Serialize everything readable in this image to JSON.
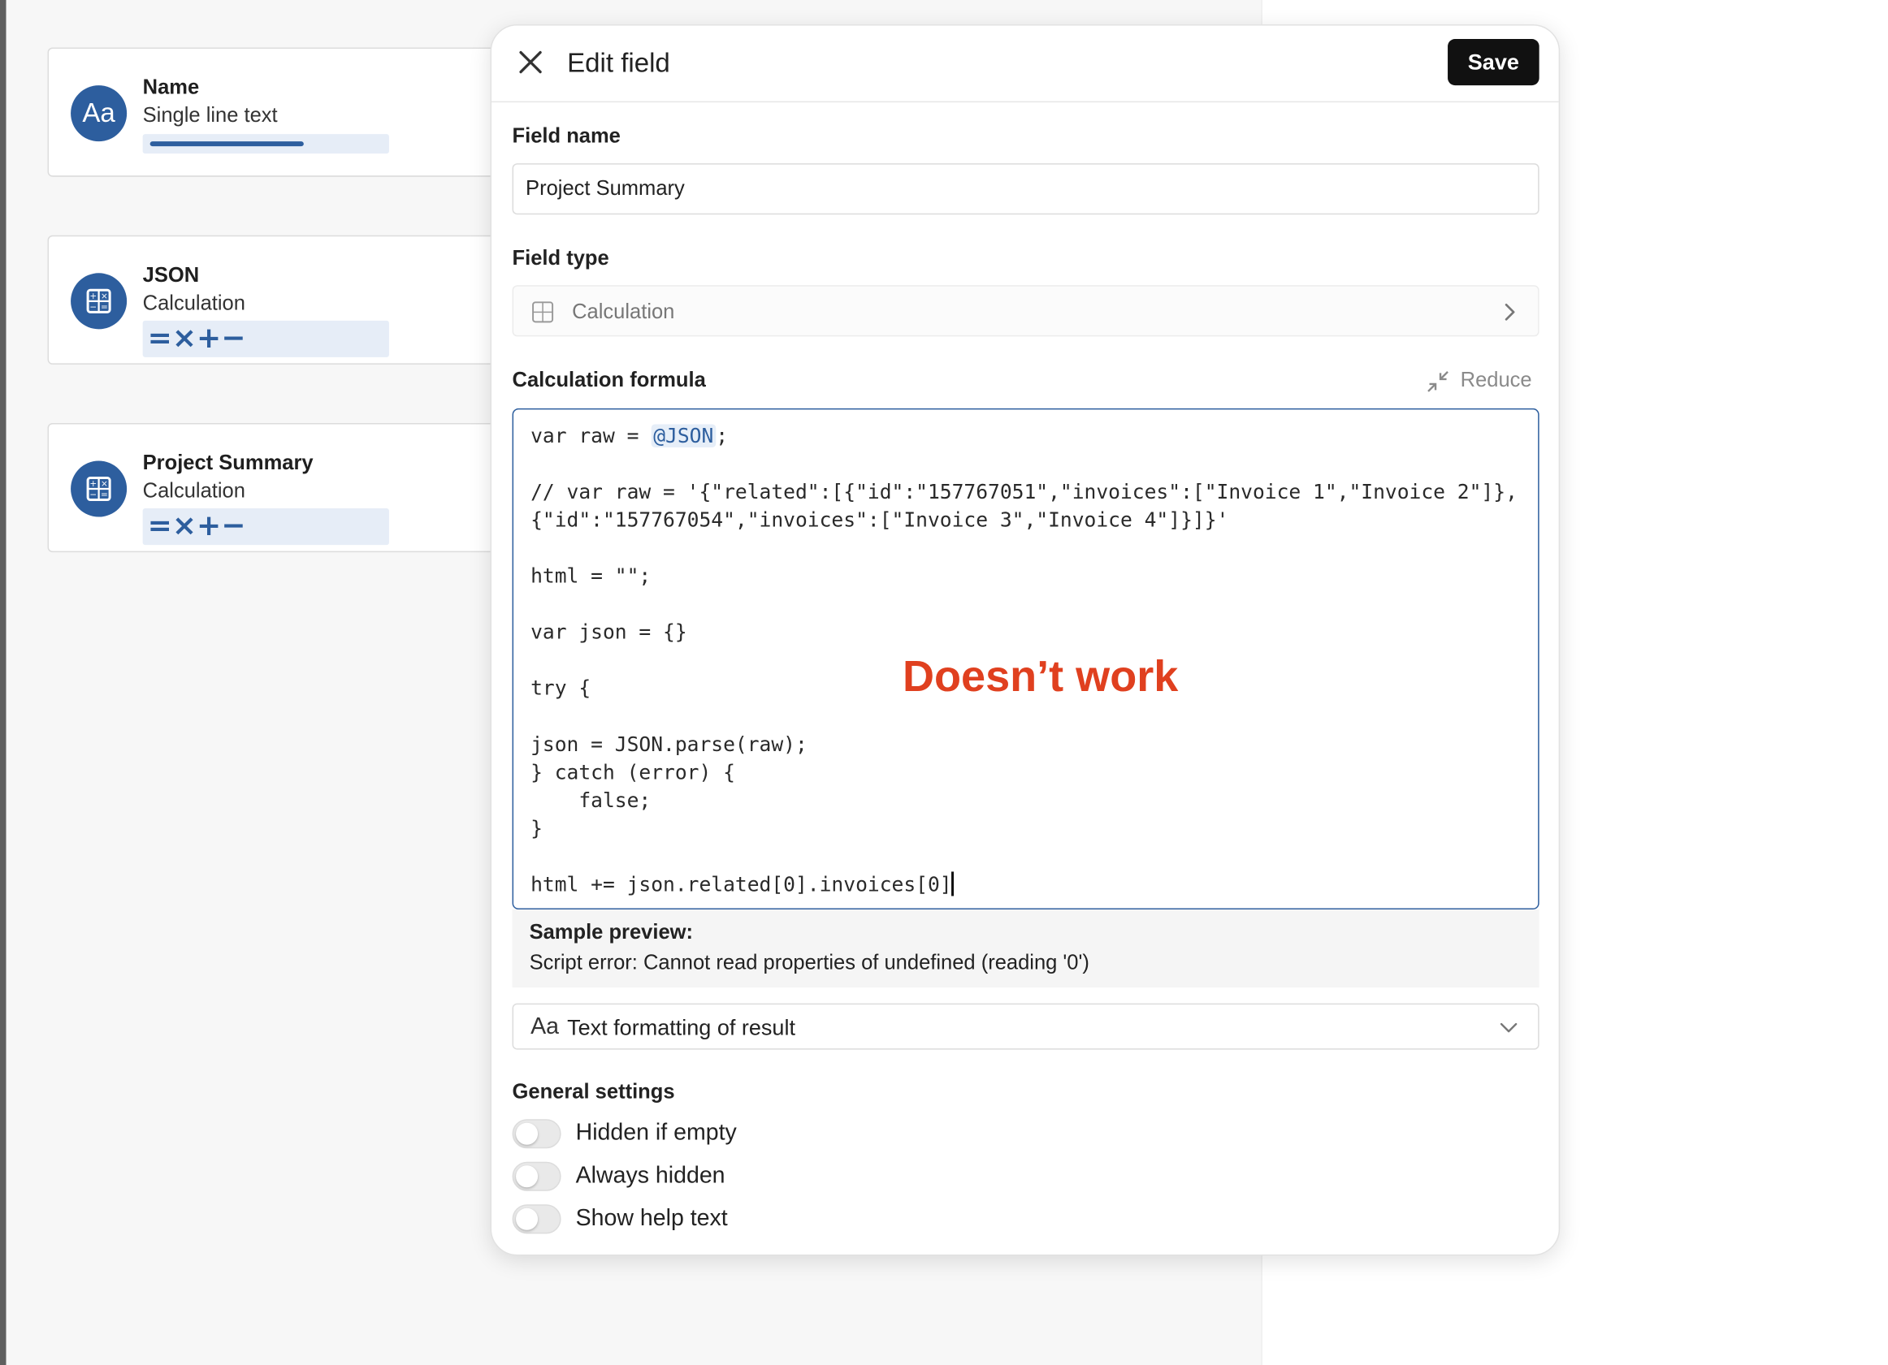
{
  "fields": [
    {
      "name": "Name",
      "type": "Single line text",
      "icon": "text-aa-icon",
      "icon_text": "Aa"
    },
    {
      "name": "JSON",
      "type": "Calculation",
      "icon": "calculator-icon",
      "ops": "=×+−"
    },
    {
      "name": "Project Summary",
      "type": "Calculation",
      "icon": "calculator-icon",
      "ops": "=×+−"
    }
  ],
  "dialog": {
    "title": "Edit field",
    "save_label": "Save",
    "field_name_label": "Field name",
    "field_name_value": "Project Summary",
    "field_type_label": "Field type",
    "field_type_value": "Calculation",
    "formula_label": "Calculation formula",
    "reduce_label": "Reduce",
    "code": {
      "line1_pre": "var raw = ",
      "line1_ref": "@JSON",
      "line1_post": ";",
      "rest": "\n\n// var raw = '{\"related\":[{\"id\":\"157767051\",\"invoices\":[\"Invoice 1\",\"Invoice 2\"]},{\"id\":\"157767054\",\"invoices\":[\"Invoice 3\",\"Invoice 4\"]}]}'\n\nhtml = \"\";\n\nvar json = {}\n\ntry {\n\njson = JSON.parse(raw);\n} catch (error) {\n    false;\n}\n\nhtml += json.related[0].invoices[0]"
    },
    "annotation": "Doesn’t work",
    "preview_title": "Sample preview:",
    "preview_value": "Script error: Cannot read properties of undefined (reading '0')",
    "format_icon_text": "Aa",
    "format_label": "Text formatting of result",
    "general_settings_label": "General settings",
    "toggles": [
      {
        "label": "Hidden if empty",
        "on": false
      },
      {
        "label": "Always hidden",
        "on": false
      },
      {
        "label": "Show help text",
        "on": false
      }
    ]
  },
  "colors": {
    "accent": "#2d5e9e",
    "annotation": "#e0401f",
    "save_bg": "#111111"
  }
}
